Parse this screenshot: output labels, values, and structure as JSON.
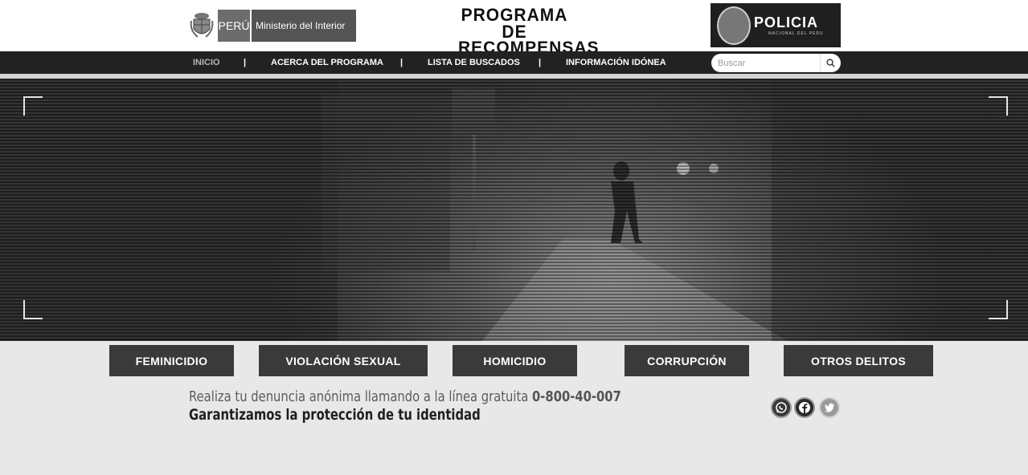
{
  "header": {
    "gov_country": "PERÚ",
    "gov_ministry": "Ministerio del Interior",
    "program_line1": "PROGRAMA DE",
    "program_line2": "RECOMPENSAS",
    "police_big": "POLICIA",
    "police_small": "NACIONAL DEL PERU"
  },
  "nav": {
    "items": [
      {
        "label": "INICIO"
      },
      {
        "label": "ACERCA DEL PROGRAMA"
      },
      {
        "label": "LISTA DE BUSCADOS"
      },
      {
        "label": "INFORMACIÓN IDÓNEA"
      }
    ],
    "separator": "|",
    "active_index": 0
  },
  "search": {
    "placeholder": "Buscar",
    "icon": "search-icon"
  },
  "categories": [
    {
      "label": "FEMINICIDIO"
    },
    {
      "label": "VIOLACIÓN SEXUAL"
    },
    {
      "label": "HOMICIDIO"
    },
    {
      "label": "CORRUPCIÓN"
    },
    {
      "label": "OTROS DELITOS"
    }
  ],
  "footer_info": {
    "line1_text": "Realiza tu denuncia anónima llamando a la línea gratuita",
    "phone": "0-800-40-007",
    "line2": "Garantizamos la protección de tu identidad"
  },
  "social": {
    "icons": [
      "whatsapp-icon",
      "facebook-icon",
      "twitter-icon"
    ]
  },
  "colors": {
    "nav_bg": "#222222",
    "button_bg": "#3a3a3a",
    "page_bg": "#e8e8e8"
  }
}
